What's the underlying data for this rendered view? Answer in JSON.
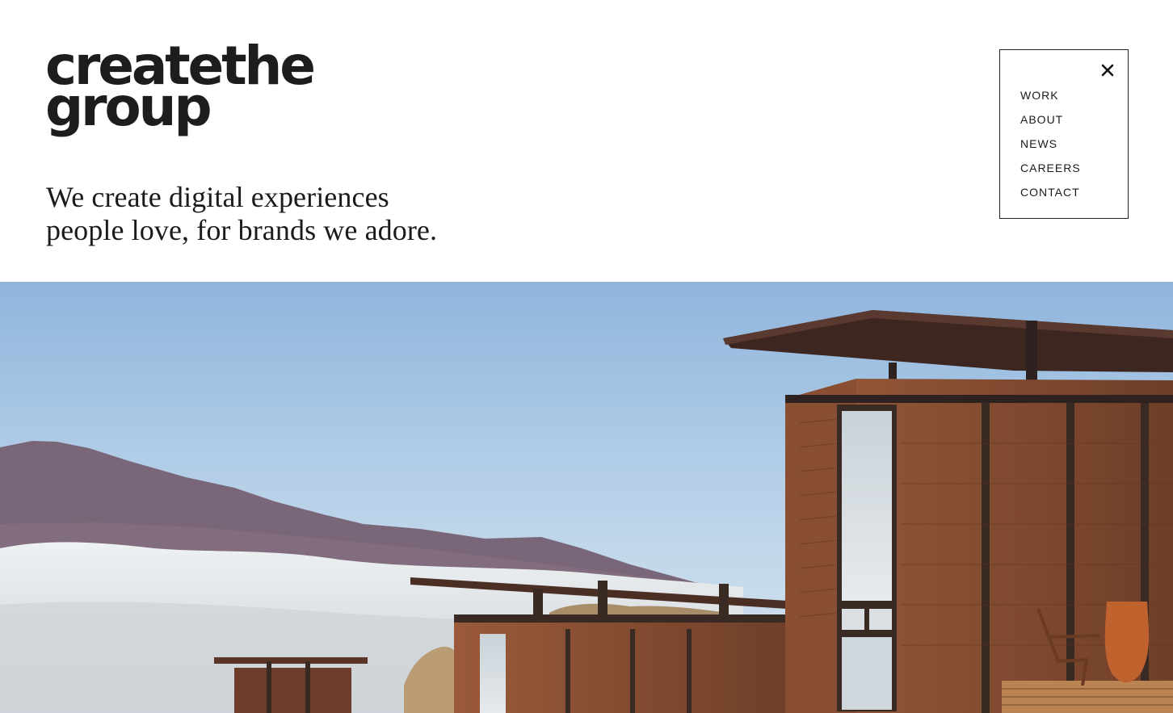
{
  "brand": {
    "logo_line1": "createthe",
    "logo_line2": "group"
  },
  "hero_text": {
    "line1": "We create digital experiences",
    "line2": "people love, for brands we adore."
  },
  "nav": {
    "close_icon": "close-icon",
    "items": [
      {
        "label": "WORK"
      },
      {
        "label": "ABOUT"
      },
      {
        "label": "NEWS"
      },
      {
        "label": "CAREERS"
      },
      {
        "label": "CONTACT"
      }
    ]
  },
  "colors": {
    "text": "#1b1b1b",
    "background": "#ffffff",
    "sky": "#9fc0e0"
  }
}
